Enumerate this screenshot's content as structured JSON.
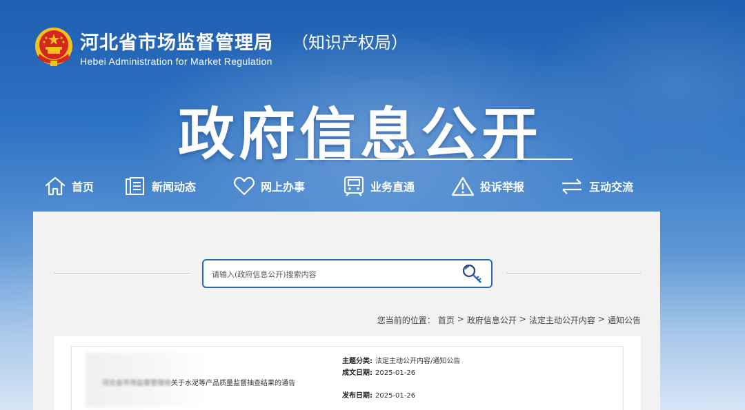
{
  "header": {
    "org_name_cn": "河北省市场监督管理局",
    "org_name_suffix": "（知识产权局）",
    "org_name_en": "Hebei Administration for Market Regulation",
    "emblem_icon": "national-emblem-icon"
  },
  "hero": {
    "title": "政府信息公开"
  },
  "nav": {
    "items": [
      {
        "label": "首页",
        "icon": "home-icon"
      },
      {
        "label": "新闻动态",
        "icon": "document-icon"
      },
      {
        "label": "网上办事",
        "icon": "heart-icon"
      },
      {
        "label": "业务直通",
        "icon": "train-icon"
      },
      {
        "label": "投诉举报",
        "icon": "warning-icon"
      },
      {
        "label": "互动交流",
        "icon": "exchange-icon"
      }
    ]
  },
  "search": {
    "placeholder": "请输入(政府信息公开)搜索内容",
    "icon": "search-key-icon"
  },
  "breadcrumb": {
    "prefix": "您当前的位置：",
    "items": [
      "首页",
      "政府信息公开",
      "法定主动公开内容",
      "通知公告"
    ],
    "separator": ">"
  },
  "document": {
    "title_blurred": "河北省市场监督管理局",
    "title_visible": "关于水泥等产品质量监督抽查结果的通告",
    "meta": [
      {
        "label": "主题分类:",
        "value": "法定主动公开内容/通知公告"
      },
      {
        "label": "成文日期:",
        "value": "2025-01-26"
      },
      {
        "label": "发布日期:",
        "value": "2025-01-26"
      }
    ]
  },
  "colors": {
    "accent": "#2b66b5",
    "emblem_red": "#d7261e",
    "emblem_gold": "#f4c21b"
  }
}
